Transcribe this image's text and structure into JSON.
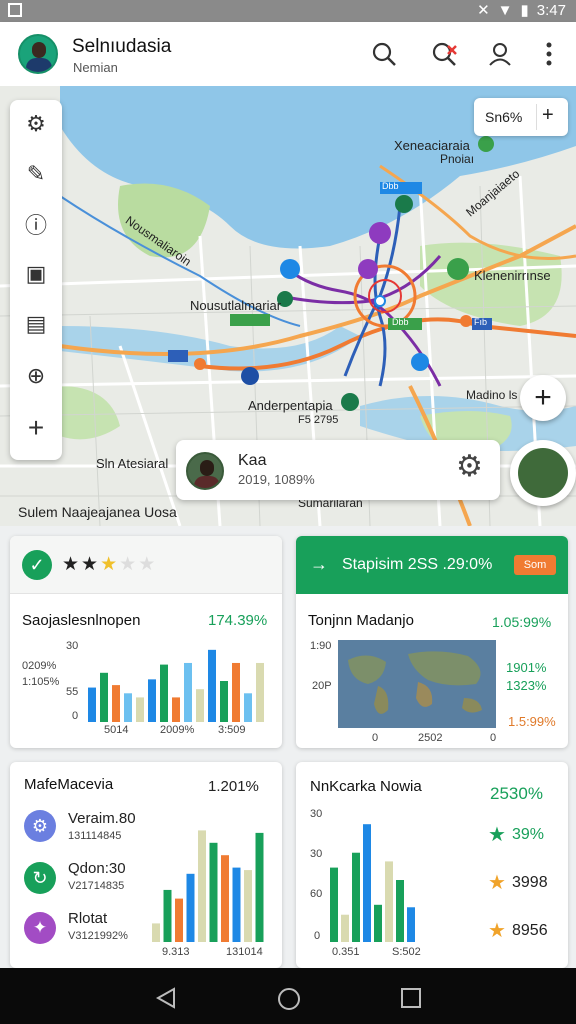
{
  "status": {
    "time": "3:47"
  },
  "header": {
    "title": "Selnıudasia",
    "subtitle": "Nemian"
  },
  "map": {
    "labels": [
      "Xeneaciaraia",
      "Pnoiaı",
      "Nousmaliaroin",
      "Moanjaiaeto",
      "Klenenirrınse",
      "Nousutlalmariar",
      "Anderpentapia",
      "F5 2795",
      "Madino ls",
      "Sln Atesiaral",
      "Sulem Naajeajanea Uosa",
      "Sumarilaran"
    ],
    "zoom_label": "Sn6%",
    "route_badges": [
      "Dbb",
      "Dbb",
      "Fıb"
    ],
    "info": {
      "name": "Kaa",
      "detail": "2019, 1089%"
    }
  },
  "cards": {
    "rating": {
      "stars": 3,
      "max": 5,
      "title": "Saojaslesnlnopen",
      "value": "174.39%",
      "y_ticks": [
        "30",
        "0209%",
        "1:105%",
        "55",
        "0"
      ],
      "x_ticks": [
        "5014",
        "2009%",
        "3:509"
      ]
    },
    "promo": {
      "text": "Stapisim 2SS .29:0%",
      "badge": "Som",
      "title": "Tonjnn Madanjo",
      "value": "1.05:99%",
      "y_ticks": [
        "1:90",
        "20P"
      ],
      "x_ticks": [
        "0",
        "2502",
        "0"
      ],
      "stats": [
        "1901%",
        "1323%",
        "1.5:99%"
      ]
    },
    "list": {
      "title": "MafeMacevia",
      "value": "1.201%",
      "items": [
        {
          "name": "Veraim.80",
          "sub": "131114845",
          "icon": "gear-icon"
        },
        {
          "name": "Qdon:30",
          "sub": "V21714835",
          "icon": "refresh-icon"
        },
        {
          "name": "Rlotat",
          "sub": "V3121992%",
          "icon": "puzzle-icon"
        }
      ],
      "x_ticks": [
        "9.313",
        "131014"
      ]
    },
    "stars": {
      "title": "NnKcarka Nowia",
      "value": "2530%",
      "y_ticks": [
        "30",
        "30",
        "60",
        "0"
      ],
      "x_ticks": [
        "0.351",
        "S:502"
      ],
      "rows": [
        "39%",
        "3998",
        "8956"
      ]
    }
  },
  "colors": {
    "accent": "#18a05a",
    "orange": "#f07b32",
    "blue": "#1e88e5",
    "water": "#8fc6e8"
  }
}
